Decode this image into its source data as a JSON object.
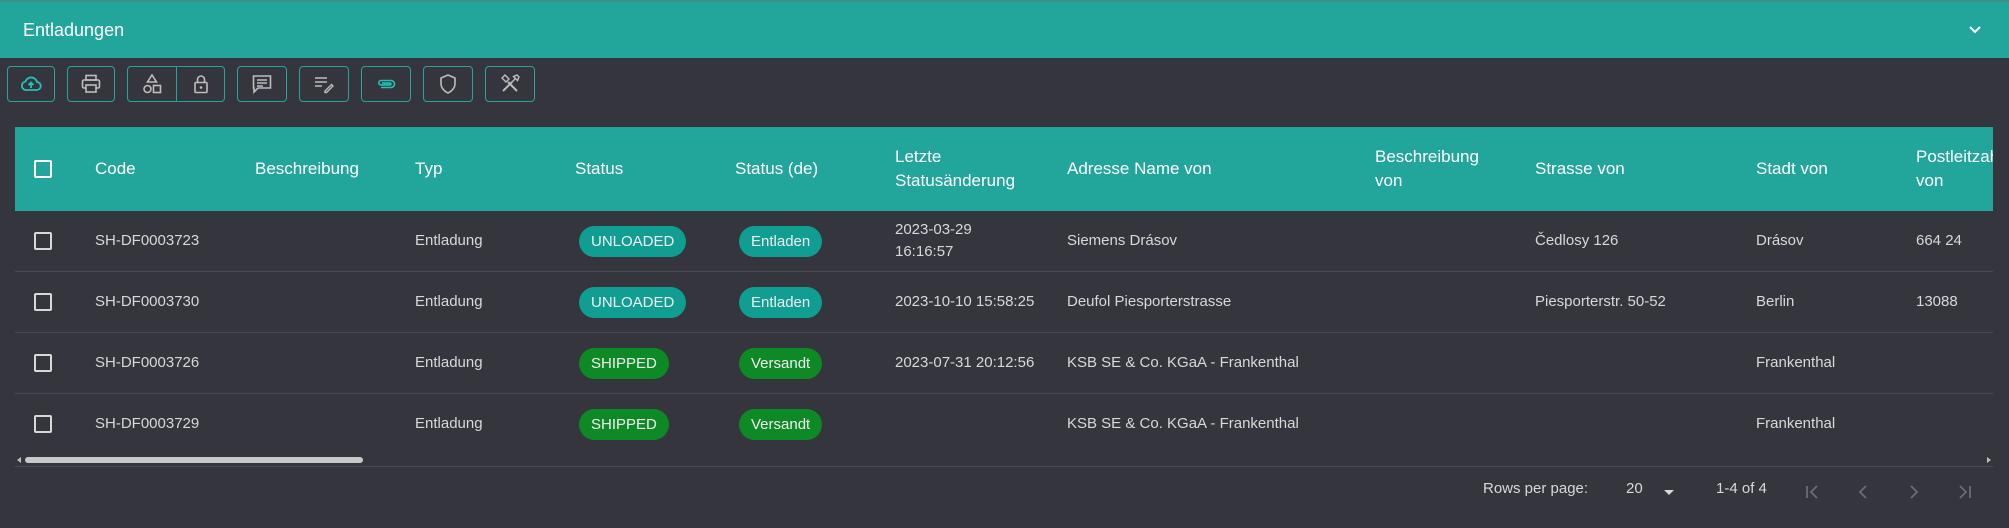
{
  "panel": {
    "title": "Entladungen"
  },
  "toolbar": {
    "buttons": [
      {
        "icon": "cloud-upload-icon"
      },
      {
        "icon": "printer-icon"
      },
      {
        "icon": "shapes-icon"
      },
      {
        "icon": "lock-icon"
      },
      {
        "icon": "comment-icon"
      },
      {
        "icon": "edit-list-icon"
      },
      {
        "icon": "paperclip-icon"
      },
      {
        "icon": "shield-icon"
      },
      {
        "icon": "tools-icon"
      }
    ]
  },
  "table": {
    "headers": {
      "code": "Code",
      "beschreibung": "Beschreibung",
      "typ": "Typ",
      "status": "Status",
      "status_de": "Status (de)",
      "letzte_1": "Letzte",
      "letzte_2": "Statusänderung",
      "adresse": "Adresse Name von",
      "beschr_von_1": "Beschreibung",
      "beschr_von_2": "von",
      "strasse": "Strasse von",
      "stadt": "Stadt von",
      "plz_1": "Postleitzahl",
      "plz_2": "von"
    },
    "rows": [
      {
        "code": "SH-DF0003723",
        "beschreibung": "",
        "typ": "Entladung",
        "status": "UNLOADED",
        "status_de": "Entladen",
        "letzte_1": "2023-03-29",
        "letzte_2": "16:16:57",
        "adresse": "Siemens Drásov",
        "beschr_von": "",
        "strasse": "Čedlosy 126",
        "stadt": "Drásov",
        "plz": "664 24"
      },
      {
        "code": "SH-DF0003730",
        "beschreibung": "",
        "typ": "Entladung",
        "status": "UNLOADED",
        "status_de": "Entladen",
        "letzte_1": "2023-10-10 15:58:25",
        "letzte_2": "",
        "adresse": "Deufol Piesporterstrasse",
        "beschr_von": "",
        "strasse": "Piesporterstr. 50-52",
        "stadt": "Berlin",
        "plz": "13088"
      },
      {
        "code": "SH-DF0003726",
        "beschreibung": "",
        "typ": "Entladung",
        "status": "SHIPPED",
        "status_de": "Versandt",
        "letzte_1": "2023-07-31 20:12:56",
        "letzte_2": "",
        "adresse": "KSB SE & Co. KGaA - Frankenthal",
        "beschr_von": "",
        "strasse": "",
        "stadt": "Frankenthal",
        "plz": ""
      },
      {
        "code": "SH-DF0003729",
        "beschreibung": "",
        "typ": "Entladung",
        "status": "SHIPPED",
        "status_de": "Versandt",
        "letzte_1": "",
        "letzte_2": "",
        "adresse": "KSB SE & Co. KGaA - Frankenthal",
        "beschr_von": "",
        "strasse": "",
        "stadt": "Frankenthal",
        "plz": ""
      }
    ]
  },
  "pagination": {
    "rows_per_page_label": "Rows per page:",
    "rows_per_page_value": "20",
    "range": "1-4 of 4"
  },
  "colors": {
    "accent": "#22a69c",
    "background": "#35353d",
    "pill_unloaded": "#109e92",
    "pill_shipped": "#0d8a25"
  }
}
